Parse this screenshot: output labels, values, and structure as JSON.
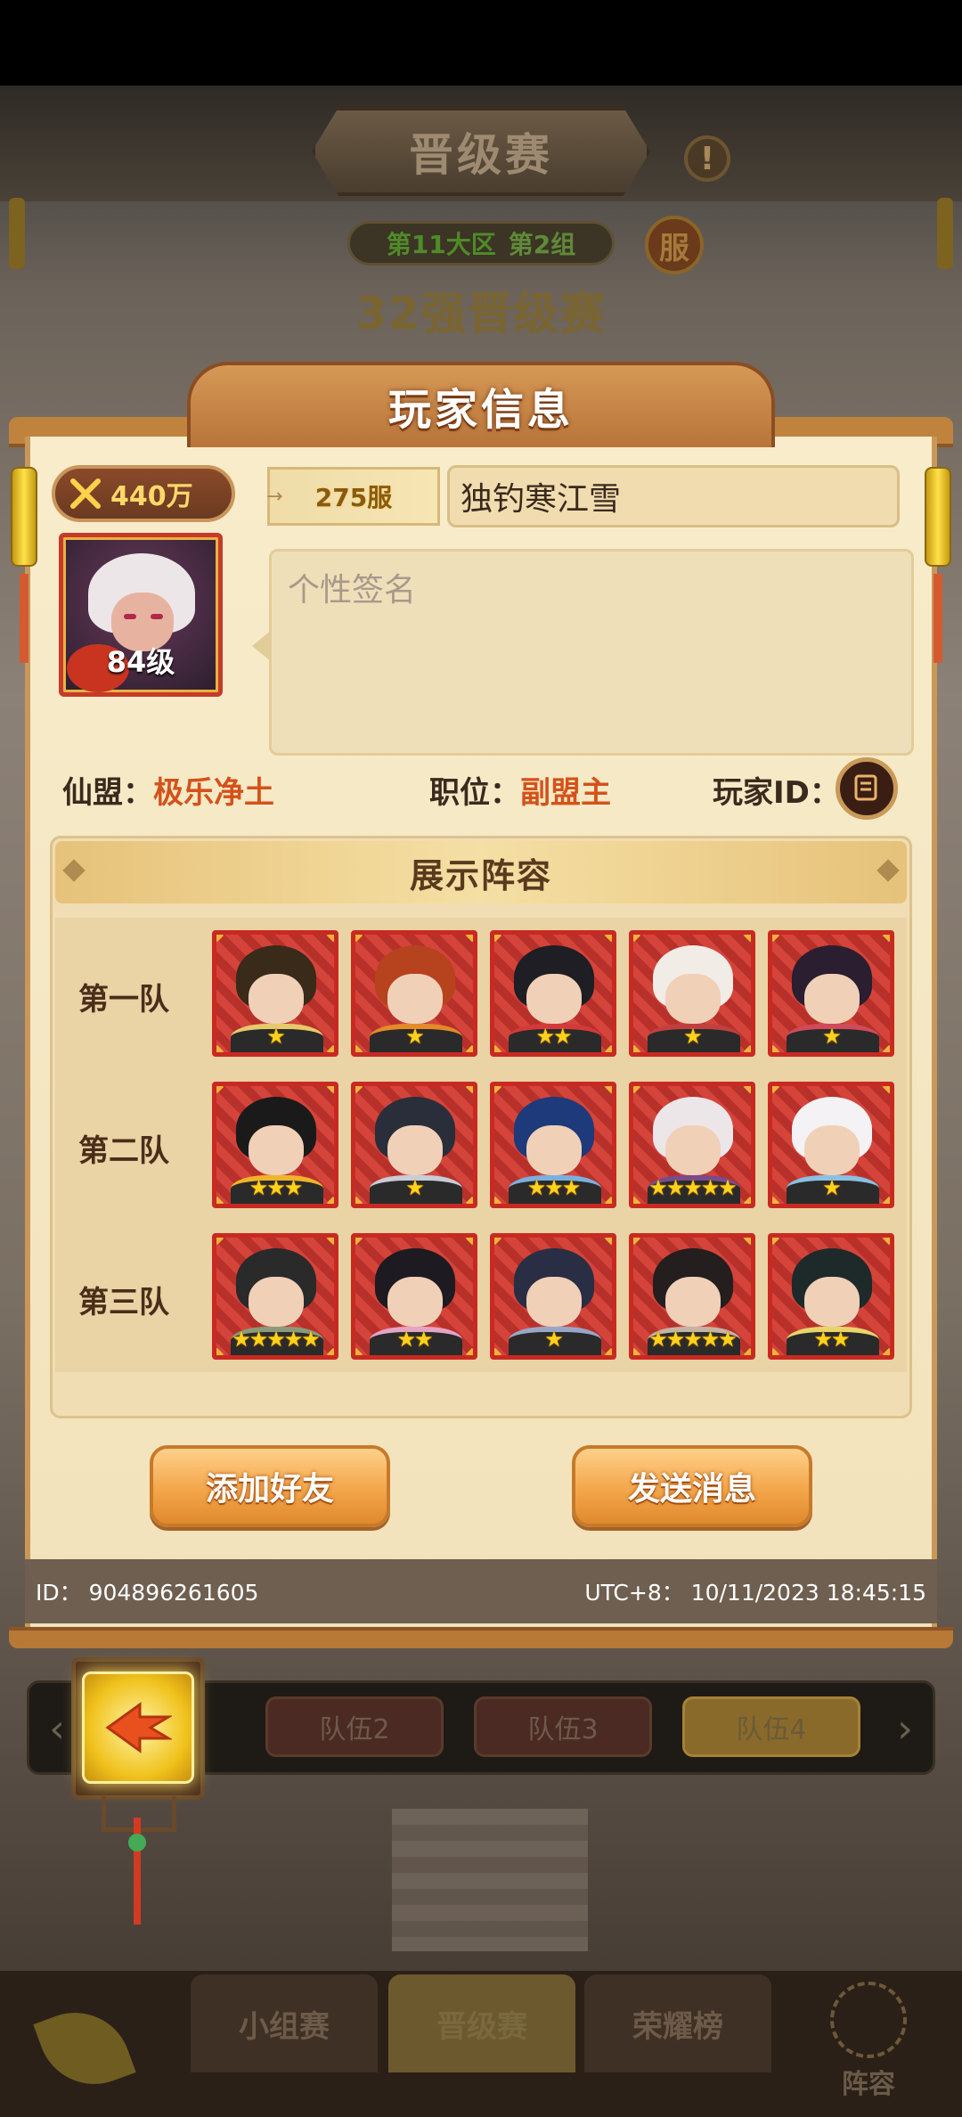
{
  "background": {
    "title": "晋级赛",
    "info_icon": "!",
    "region": "第11大区",
    "group": "第2组",
    "server_badge": "服",
    "stage": "32强晋级赛",
    "team_tabs": [
      "队伍2",
      "队伍3",
      "队伍4"
    ],
    "active_team_tab": "队伍4",
    "bottom_tabs": [
      "小组赛",
      "晋级赛",
      "荣耀榜"
    ],
    "active_bottom_tab": "晋级赛",
    "lineup_label": "阵容"
  },
  "panel": {
    "title": "玩家信息",
    "power": "440万",
    "server": "275服",
    "player_name": "独钓寒江雪",
    "level": "84级",
    "signature_placeholder": "个性签名",
    "alliance_label": "仙盟：",
    "alliance_value": "极乐净土",
    "position_label": "职位：",
    "position_value": "副盟主",
    "player_id_label": "玩家ID：",
    "lineup_title": "展示阵容",
    "teams": [
      {
        "label": "第一队",
        "heroes": [
          {
            "stars": 1,
            "hair": "#3a2a1a",
            "accent": "#e7c86a"
          },
          {
            "stars": 1,
            "hair": "#b6431e",
            "accent": "#e48a2a"
          },
          {
            "stars": 2,
            "hair": "#1e1e24",
            "accent": "#d43a3a"
          },
          {
            "stars": 1,
            "hair": "#f1ece6",
            "accent": "#c04040"
          },
          {
            "stars": 1,
            "hair": "#2a1e30",
            "accent": "#d04a5a"
          }
        ]
      },
      {
        "label": "第二队",
        "heroes": [
          {
            "stars": 3,
            "hair": "#1a1a1a",
            "accent": "#f0b42a"
          },
          {
            "stars": 1,
            "hair": "#2a2e3a",
            "accent": "#c8ccd6"
          },
          {
            "stars": 3,
            "hair": "#1e3a7a",
            "accent": "#7ab0e0"
          },
          {
            "stars": 5,
            "hair": "#ede6e9",
            "accent": "#7a4a8a"
          },
          {
            "stars": 1,
            "hair": "#f4f2f4",
            "accent": "#8ac0e0"
          }
        ]
      },
      {
        "label": "第三队",
        "heroes": [
          {
            "stars": 5,
            "hair": "#2a2a2a",
            "accent": "#8a9a7a"
          },
          {
            "stars": 2,
            "hair": "#1e1a22",
            "accent": "#e4a4c4"
          },
          {
            "stars": 1,
            "hair": "#2a2e44",
            "accent": "#9aa6c8"
          },
          {
            "stars": 5,
            "hair": "#241e1e",
            "accent": "#c4b4a4"
          },
          {
            "stars": 2,
            "hair": "#1e2a2a",
            "accent": "#e8d46a"
          }
        ]
      }
    ],
    "add_friend": "添加好友",
    "send_message": "发送消息",
    "id_text": "ID：  904896261605",
    "time_text": "UTC+8：  10/11/2023 18:45:15"
  }
}
